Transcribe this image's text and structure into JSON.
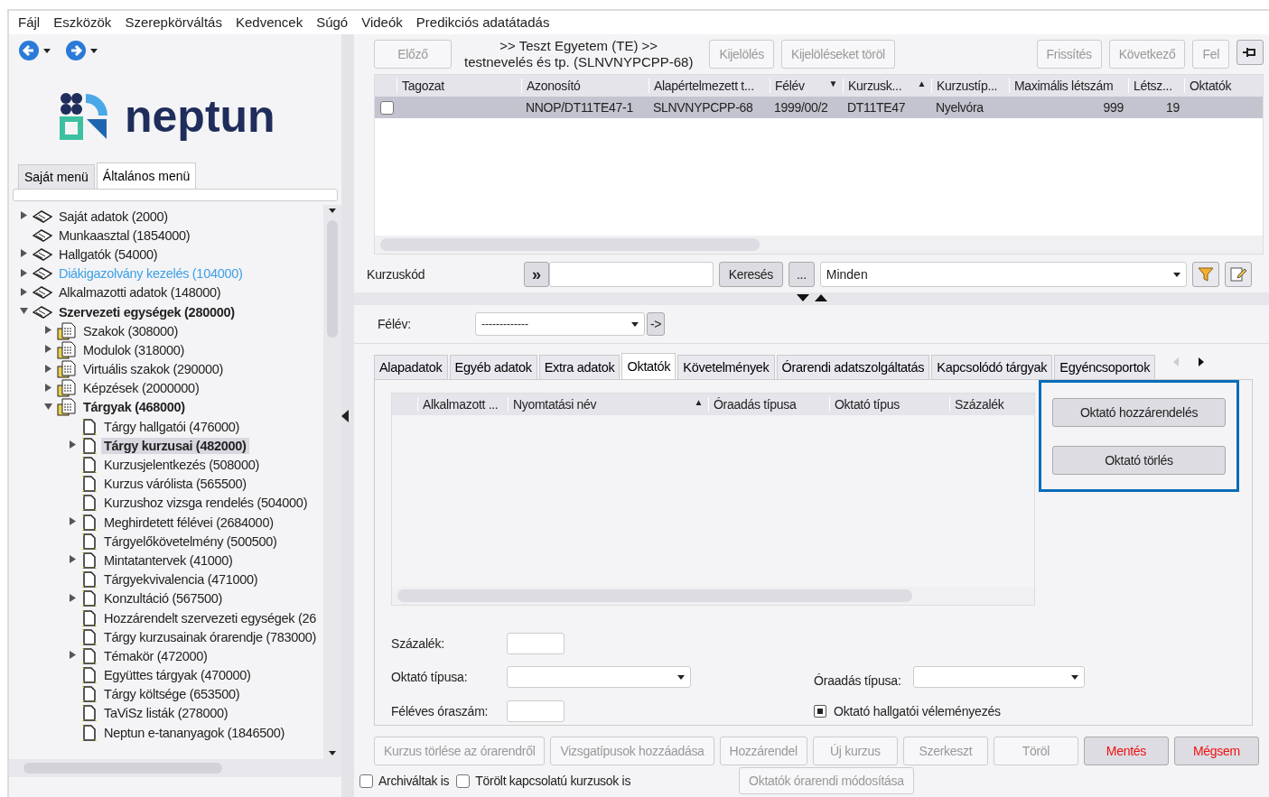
{
  "menu": [
    "Fájl",
    "Eszközök",
    "Szerepkörváltás",
    "Kedvencek",
    "Súgó",
    "Videók",
    "Predikciós adatátadás"
  ],
  "logo": {
    "text": "neptun"
  },
  "menu_tabs": [
    {
      "label": "Saját menü",
      "selected": false
    },
    {
      "label": "Általános menü",
      "selected": true
    }
  ],
  "tree": [
    {
      "label": "Saját adatok (2000)",
      "kind": "book",
      "expanded": false,
      "selected": false
    },
    {
      "label": "Munkaasztal (1854000)",
      "kind": "book",
      "selected": false
    },
    {
      "label": "Hallgatók (54000)",
      "kind": "book",
      "expanded": false,
      "selected": false
    },
    {
      "label": "Diákigazolvány kezelés (104000)",
      "kind": "book",
      "expanded": false,
      "selected": false,
      "muted": true
    },
    {
      "label": "Alkalmazotti adatok (148000)",
      "kind": "book",
      "expanded": false,
      "selected": false
    },
    {
      "label": "Szervezeti egységek (280000)",
      "kind": "book",
      "expanded": true,
      "selected": false,
      "children": [
        {
          "label": "Szakok (308000)",
          "kind": "unit",
          "expanded": false,
          "selected": false
        },
        {
          "label": "Modulok (318000)",
          "kind": "unit",
          "expanded": false,
          "selected": false
        },
        {
          "label": "Virtuális szakok (290000)",
          "kind": "unit",
          "expanded": false,
          "selected": false
        },
        {
          "label": "Képzések (2000000)",
          "kind": "unit",
          "expanded": false,
          "selected": false
        },
        {
          "label": "Tárgyak (468000)",
          "kind": "unit",
          "expanded": true,
          "selected": false,
          "children": [
            {
              "label": "Tárgy hallgatói (476000)",
              "kind": "page",
              "selected": false
            },
            {
              "label": "Tárgy kurzusai (482000)",
              "kind": "page",
              "expanded": false,
              "selected": true
            },
            {
              "label": "Kurzusjelentkezés (508000)",
              "kind": "page",
              "selected": false
            },
            {
              "label": "Kurzus várólista (565500)",
              "kind": "page",
              "selected": false
            },
            {
              "label": "Kurzushoz vizsga rendelés (504000)",
              "kind": "page",
              "selected": false
            },
            {
              "label": "Meghirdetett félévei (2684000)",
              "kind": "page",
              "expanded": false,
              "selected": false
            },
            {
              "label": "Tárgyelőkövetelmény (500500)",
              "kind": "page",
              "selected": false
            },
            {
              "label": "Mintatantervek (41000)",
              "kind": "page",
              "expanded": false,
              "selected": false
            },
            {
              "label": "Tárgyekvivalencia (471000)",
              "kind": "page",
              "selected": false
            },
            {
              "label": "Konzultáció (567500)",
              "kind": "page",
              "expanded": false,
              "selected": false
            },
            {
              "label": "Hozzárendelt szervezeti egységek (26",
              "kind": "page",
              "selected": false
            },
            {
              "label": "Tárgy kurzusainak órarendje (783000)",
              "kind": "page",
              "selected": false
            },
            {
              "label": "Témakör (472000)",
              "kind": "page",
              "expanded": false,
              "selected": false
            },
            {
              "label": "Együttes tárgyak (470000)",
              "kind": "page",
              "selected": false
            },
            {
              "label": "Tárgy költsége (653500)",
              "kind": "page",
              "selected": false
            },
            {
              "label": "TaViSz listák (278000)",
              "kind": "page",
              "selected": false
            },
            {
              "label": "Neptun e-tananyagok (1846500)",
              "kind": "page",
              "selected": false
            }
          ]
        }
      ]
    }
  ],
  "toolbar": {
    "prev": {
      "label": "Előző",
      "disabled": true
    },
    "breadcrumb": [
      ">> Teszt Egyetem (TE) >>",
      "testnevelés és tp. (SLNVNYPCPP-68)"
    ],
    "buttons": [
      {
        "label": "Kijelölés",
        "disabled": true
      },
      {
        "label": "Kijelöléseket töröl",
        "disabled": true
      }
    ],
    "right_buttons": [
      {
        "label": "Frissítés",
        "disabled": true
      },
      {
        "label": "Következő",
        "disabled": true
      },
      {
        "label": "Fel",
        "disabled": true
      }
    ]
  },
  "table": {
    "columns": [
      {
        "label": "Tagozat"
      },
      {
        "label": "Azonosító"
      },
      {
        "label": "Alapértelmezett t..."
      },
      {
        "label": "Félév",
        "sort": "▼"
      },
      {
        "label": "Kurzusk...",
        "sort": "▲"
      },
      {
        "label": "Kurzustíp..."
      },
      {
        "label": "Maximális létszám"
      },
      {
        "label": "Létsz..."
      },
      {
        "label": "Oktatók"
      }
    ],
    "rows": [
      {
        "checked": false,
        "selected": true,
        "cells": [
          "",
          "NNOP/DT11TE47-1",
          "SLNVNYPCPP-68",
          "1999/00/2",
          "DT11TE47",
          "Nyelvóra",
          "999",
          "19",
          ""
        ]
      }
    ]
  },
  "search": {
    "label": "Kurzuskód",
    "go": "»",
    "button": "Keresés",
    "more": "...",
    "filter": "Minden"
  },
  "semester": {
    "label": "Félév:",
    "value": "-------------",
    "go": "->"
  },
  "tabs": [
    {
      "label": "Alapadatok",
      "selected": false
    },
    {
      "label": "Egyéb adatok",
      "selected": false
    },
    {
      "label": "Extra adatok",
      "selected": false
    },
    {
      "label": "Oktatók",
      "selected": true
    },
    {
      "label": "Követelmények",
      "selected": false
    },
    {
      "label": "Órarendi adatszolgáltatás",
      "selected": false
    },
    {
      "label": "Kapcsolódó tárgyak",
      "selected": false
    },
    {
      "label": "Egyéncsoportok",
      "selected": false
    }
  ],
  "teachers": {
    "columns": [
      {
        "label": "Alkalmazott ..."
      },
      {
        "label": "Nyomtatási név",
        "sort": "▲"
      },
      {
        "label": "Óraadás típusa"
      },
      {
        "label": "Oktató típus"
      },
      {
        "label": "Százalék"
      }
    ],
    "buttons": [
      "Oktató hozzárendelés",
      "Oktató törlés"
    ],
    "form": {
      "percent": "Százalék:",
      "teacher_type": "Oktató típusa:",
      "hours": "Féléves óraszám:",
      "delivery_type": "Óraadás típusa:",
      "evaluation": {
        "label": "Oktató hallgatói véleményezés",
        "checked": true
      }
    }
  },
  "actions": [
    {
      "label": "Kurzus törlése az órarendről",
      "disabled": true
    },
    {
      "label": "Vizsgatípusok hozzáadása",
      "disabled": true
    },
    {
      "label": "Hozzárendel",
      "disabled": true
    },
    {
      "label": "Új kurzus",
      "disabled": true
    },
    {
      "label": "Szerkeszt",
      "disabled": true
    },
    {
      "label": "Töröl",
      "disabled": true
    },
    {
      "label": "Mentés",
      "disabled": false
    },
    {
      "label": "Mégsem",
      "disabled": false
    }
  ],
  "options": [
    {
      "label": "Archiváltak is",
      "checked": false
    },
    {
      "label": "Törölt kapcsolatú kurzusok is",
      "checked": false
    }
  ],
  "extra_button": {
    "label": "Oktatók órarendi módosítása",
    "disabled": true
  }
}
